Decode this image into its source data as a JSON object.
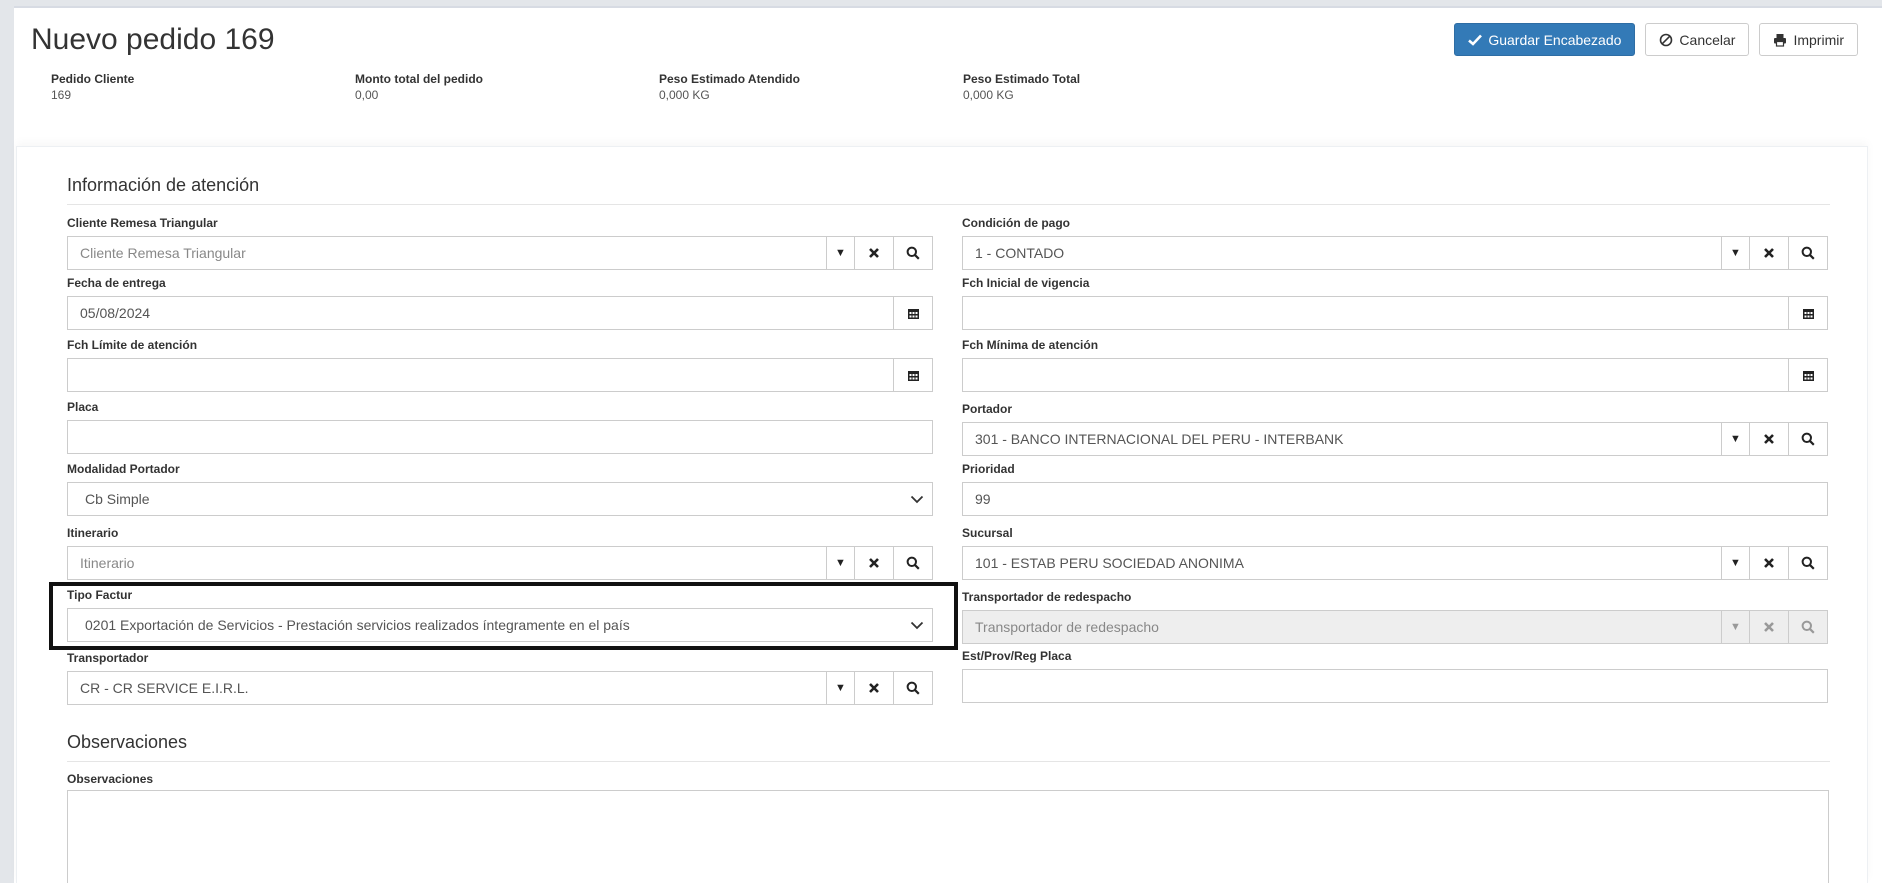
{
  "header": {
    "title": "Nuevo pedido 169",
    "buttons": {
      "save": "Guardar Encabezado",
      "cancel": "Cancelar",
      "print": "Imprimir"
    }
  },
  "stats": [
    {
      "label": "Pedido Cliente",
      "value": "169"
    },
    {
      "label": "Monto total del pedido",
      "value": "0,00"
    },
    {
      "label": "Peso Estimado Atendido",
      "value": "0,000 KG"
    },
    {
      "label": "Peso Estimado Total",
      "value": "0,000 KG"
    }
  ],
  "sections": {
    "atencion": "Información de atención",
    "observaciones": "Observaciones"
  },
  "left": {
    "cliente_remesa": {
      "label": "Cliente Remesa Triangular",
      "placeholder": "Cliente Remesa Triangular",
      "value": ""
    },
    "fecha_entrega": {
      "label": "Fecha de entrega",
      "value": "05/08/2024"
    },
    "fch_limite": {
      "label": "Fch Límite de atención",
      "value": ""
    },
    "placa": {
      "label": "Placa",
      "value": ""
    },
    "modalidad": {
      "label": "Modalidad Portador",
      "value": "Cb Simple"
    },
    "itinerario": {
      "label": "Itinerario",
      "placeholder": "Itinerario",
      "value": ""
    },
    "tipo_factur": {
      "label": "Tipo Factur",
      "value": "0201 Exportación de Servicios - Prestación servicios realizados íntegramente en el país"
    },
    "transportador": {
      "label": "Transportador",
      "value": "CR - CR SERVICE E.I.R.L."
    }
  },
  "right": {
    "condicion_pago": {
      "label": "Condición de pago",
      "value": "1 - CONTADO"
    },
    "fch_inicial": {
      "label": "Fch Inicial de vigencia",
      "value": ""
    },
    "fch_minima": {
      "label": "Fch Mínima de atención",
      "value": ""
    },
    "portador": {
      "label": "Portador",
      "value": "301 - BANCO INTERNACIONAL DEL PERU - INTERBANK"
    },
    "prioridad": {
      "label": "Prioridad",
      "value": "99"
    },
    "sucursal": {
      "label": "Sucursal",
      "value": "101 - ESTAB PERU SOCIEDAD ANONIMA"
    },
    "transp_redespacho": {
      "label": "Transportador de redespacho",
      "placeholder": "Transportador de redespacho",
      "value": ""
    },
    "est_prov": {
      "label": "Est/Prov/Reg Placa",
      "value": ""
    }
  },
  "observaciones": {
    "label": "Observaciones",
    "value": ""
  },
  "colors": {
    "primary": "#337ab7",
    "highlight_border": "#111111"
  }
}
